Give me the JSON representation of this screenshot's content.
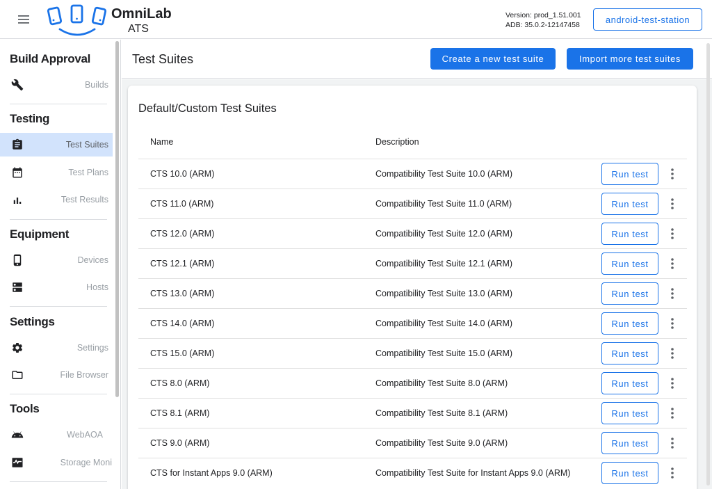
{
  "header": {
    "menu_icon": "menu-icon",
    "logo_icon": "phones-logo-icon",
    "brand_title": "OmniLab",
    "brand_subtitle": "ATS",
    "version_line": "Version: prod_1.51.001",
    "adb_line": "ADB: 35.0.2-12147458",
    "station_label": "android-test-station"
  },
  "sidebar": {
    "sections": [
      {
        "title": "Build Approval",
        "items": [
          {
            "label": "Builds",
            "icon": "wrench-icon"
          }
        ]
      },
      {
        "title": "Testing",
        "items": [
          {
            "label": "Test Suites",
            "icon": "clipboard-icon",
            "active": true
          },
          {
            "label": "Test Plans",
            "icon": "calendar-icon"
          },
          {
            "label": "Test Results",
            "icon": "bar-chart-icon"
          }
        ]
      },
      {
        "title": "Equipment",
        "items": [
          {
            "label": "Devices",
            "icon": "phone-icon"
          },
          {
            "label": "Hosts",
            "icon": "server-icon"
          }
        ]
      },
      {
        "title": "Settings",
        "items": [
          {
            "label": "Settings",
            "icon": "gear-icon"
          },
          {
            "label": "File Browser",
            "icon": "folder-icon"
          }
        ]
      },
      {
        "title": "Tools",
        "items": [
          {
            "label": "WebAOA",
            "icon": "android-icon"
          },
          {
            "label": "Storage Moni",
            "icon": "monitor-icon"
          }
        ]
      }
    ]
  },
  "main": {
    "page_title": "Test Suites",
    "create_label": "Create a new test suite",
    "import_label": "Import more test suites",
    "card_title": "Default/Custom Test Suites",
    "columns": {
      "name": "Name",
      "description": "Description"
    },
    "run_label": "Run test",
    "more_icon": "more-vert-icon",
    "rows": [
      {
        "name": "CTS 10.0 (ARM)",
        "description": "Compatibility Test Suite 10.0 (ARM)"
      },
      {
        "name": "CTS 11.0 (ARM)",
        "description": "Compatibility Test Suite 11.0 (ARM)"
      },
      {
        "name": "CTS 12.0 (ARM)",
        "description": "Compatibility Test Suite 12.0 (ARM)"
      },
      {
        "name": "CTS 12.1 (ARM)",
        "description": "Compatibility Test Suite 12.1 (ARM)"
      },
      {
        "name": "CTS 13.0 (ARM)",
        "description": "Compatibility Test Suite 13.0 (ARM)"
      },
      {
        "name": "CTS 14.0 (ARM)",
        "description": "Compatibility Test Suite 14.0 (ARM)"
      },
      {
        "name": "CTS 15.0 (ARM)",
        "description": "Compatibility Test Suite 15.0 (ARM)"
      },
      {
        "name": "CTS 8.0 (ARM)",
        "description": "Compatibility Test Suite 8.0 (ARM)"
      },
      {
        "name": "CTS 8.1 (ARM)",
        "description": "Compatibility Test Suite 8.1 (ARM)"
      },
      {
        "name": "CTS 9.0 (ARM)",
        "description": "Compatibility Test Suite 9.0 (ARM)"
      },
      {
        "name": "CTS for Instant Apps 9.0 (ARM)",
        "description": "Compatibility Test Suite for Instant Apps 9.0 (ARM)"
      }
    ]
  },
  "colors": {
    "accent": "#1a73e8",
    "active_nav": "#d2e3fc",
    "page_bg": "#f1f3f4"
  }
}
